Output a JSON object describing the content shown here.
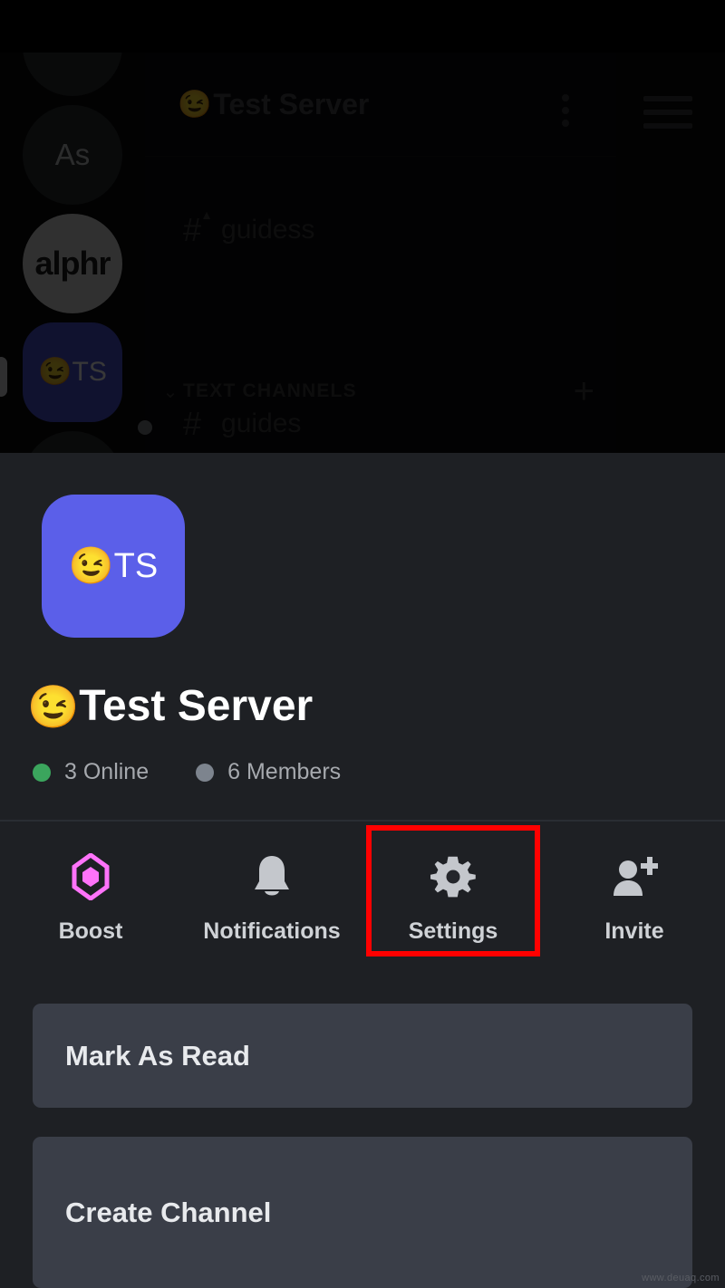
{
  "background_app": {
    "server_rail": {
      "items": [
        {
          "label": "",
          "type": "circle-avatar"
        },
        {
          "label": "As",
          "type": "circle-avatar"
        },
        {
          "label": "alphr",
          "type": "circle-avatar"
        },
        {
          "label": "TS",
          "emoji": "😉",
          "type": "squircle-avatar-selected"
        },
        {
          "label": "",
          "type": "circle-avatar"
        }
      ]
    },
    "channel_panel": {
      "header_title": "Test Server",
      "header_emoji": "😉",
      "kebab_icon": "more-vertical-icon",
      "hamburger_icon": "hamburger-menu-icon",
      "channels_above": [
        {
          "name": "guidess",
          "hash": "#",
          "locked": true
        }
      ],
      "category": {
        "label": "TEXT CHANNELS",
        "chevron": "⌄",
        "add_label": "+"
      },
      "channels_below": [
        {
          "name": "guides",
          "hash": "#",
          "unread": true
        }
      ]
    }
  },
  "sheet": {
    "server_tile": {
      "emoji": "😉",
      "initials": "TS",
      "background_color": "#5b5fe9"
    },
    "server_name": "Test Server",
    "server_name_emoji": "😉",
    "stats": [
      {
        "label": "3 Online",
        "dot_color": "#3ba55d",
        "dot_name": "online-status-dot"
      },
      {
        "label": "6 Members",
        "dot_color": "#7d848e",
        "dot_name": "members-status-dot"
      }
    ],
    "actions": [
      {
        "label": "Boost",
        "icon": "boost-gem-icon",
        "color": "#ff73fa"
      },
      {
        "label": "Notifications",
        "icon": "bell-icon",
        "color": "#c4c7cc"
      },
      {
        "label": "Settings",
        "icon": "gear-icon",
        "color": "#c4c7cc",
        "highlighted": true
      },
      {
        "label": "Invite",
        "icon": "person-add-icon",
        "color": "#c4c7cc"
      }
    ],
    "menu_items": [
      {
        "label": "Mark As Read"
      },
      {
        "label": "Create Channel"
      }
    ]
  },
  "annotation": {
    "highlight_color": "#ff0000",
    "highlight_target": "Settings"
  },
  "watermark": "www.deuaq.com"
}
